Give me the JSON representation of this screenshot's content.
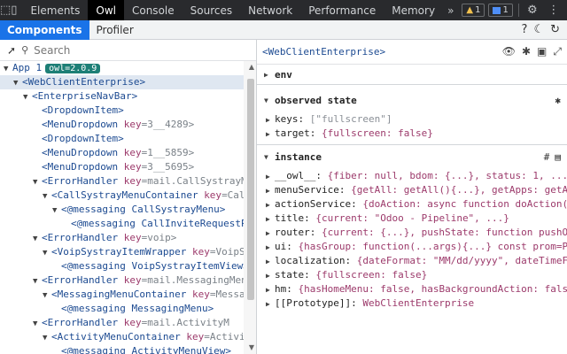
{
  "devtools": {
    "tabs": [
      "Elements",
      "Owl",
      "Console",
      "Sources",
      "Network",
      "Performance",
      "Memory"
    ],
    "active_tab": "Owl",
    "more": "»",
    "warnings_count": "1",
    "messages_count": "1"
  },
  "owl": {
    "tabs": [
      "Components",
      "Profiler"
    ],
    "active_tab": "Components"
  },
  "search": {
    "placeholder": "Search"
  },
  "tree": {
    "app": "App 1",
    "owl_version": "owl=2.0.9",
    "rows": [
      {
        "indent": 1,
        "arrow": "▼",
        "text": "<WebClientEnterprise>",
        "sel": true
      },
      {
        "indent": 2,
        "arrow": "▼",
        "text": "<EnterpriseNavBar>"
      },
      {
        "indent": 3,
        "arrow": "",
        "text": "<DropdownItem>"
      },
      {
        "indent": 3,
        "arrow": "",
        "text": "<MenuDropdown ",
        "k": "key",
        "v": "=3__4289>"
      },
      {
        "indent": 3,
        "arrow": "",
        "text": "<DropdownItem>"
      },
      {
        "indent": 3,
        "arrow": "",
        "text": "<MenuDropdown ",
        "k": "key",
        "v": "=1__5859>"
      },
      {
        "indent": 3,
        "arrow": "",
        "text": "<MenuDropdown ",
        "k": "key",
        "v": "=3__5695>"
      },
      {
        "indent": 3,
        "arrow": "▼",
        "text": "<ErrorHandler ",
        "k": "key",
        "v": "=mail.CallSystrayMe"
      },
      {
        "indent": 4,
        "arrow": "▼",
        "text": "<CallSystrayMenuContainer ",
        "k": "key",
        "v": "=CallS"
      },
      {
        "indent": 5,
        "arrow": "▼",
        "text": "<@messaging CallSystrayMenu>"
      },
      {
        "indent": 6,
        "arrow": "",
        "text": "<@messaging CallInviteRequestPo"
      },
      {
        "indent": 3,
        "arrow": "▼",
        "text": "<ErrorHandler ",
        "k": "key",
        "v": "=voip>"
      },
      {
        "indent": 4,
        "arrow": "▼",
        "text": "<VoipSystrayItemWrapper ",
        "k": "key",
        "v": "=VoipSy"
      },
      {
        "indent": 5,
        "arrow": "",
        "text": "<@messaging VoipSystrayItemView>"
      },
      {
        "indent": 3,
        "arrow": "▼",
        "text": "<ErrorHandler ",
        "k": "key",
        "v": "=mail.MessagingMenu"
      },
      {
        "indent": 4,
        "arrow": "▼",
        "text": "<MessagingMenuContainer ",
        "k": "key",
        "v": "=Messag"
      },
      {
        "indent": 5,
        "arrow": "",
        "text": "<@messaging MessagingMenu>"
      },
      {
        "indent": 3,
        "arrow": "▼",
        "text": "<ErrorHandler ",
        "k": "key",
        "v": "=mail.ActivityM"
      },
      {
        "indent": 4,
        "arrow": "▼",
        "text": "<ActivityMenuContainer ",
        "k": "key",
        "v": "=ActivityMe"
      },
      {
        "indent": 5,
        "arrow": "",
        "text": "<@messaging ActivityMenuView>"
      }
    ]
  },
  "detail": {
    "component": "<WebClientEnterprise>",
    "env_label": "env",
    "observed_label": "observed state",
    "observed": [
      {
        "k": "keys:",
        "v": "[\"fullscreen\"]",
        "style": "str"
      },
      {
        "k": "target:",
        "v": "{fullscreen: false}"
      }
    ],
    "instance_label": "instance",
    "instance": [
      {
        "k": "__owl__:",
        "v": "{fiber: null, bdom: {...}, status: 1, ..."
      },
      {
        "k": "menuService:",
        "v": "{getAll: getAll(){...}, getApps: getApps"
      },
      {
        "k": "actionService:",
        "v": "{doAction: async function doAction(ac"
      },
      {
        "k": "title:",
        "v": "{current: \"Odoo - Pipeline\", ...}"
      },
      {
        "k": "router:",
        "v": "{current: {...}, pushState: function pushOrR"
      },
      {
        "k": "ui:",
        "v": "{hasGroup: function(...args){...} const prom=P"
      },
      {
        "k": "localization:",
        "v": "{dateFormat: \"MM/dd/yyyy\", dateTimeFor"
      },
      {
        "k": "state:",
        "v": "{fullscreen: false}"
      },
      {
        "k": "hm:",
        "v": "{hasHomeMenu: false, hasBackgroundAction: false,"
      },
      {
        "k": "[[Prototype]]:",
        "v": "WebClientEnterprise",
        "style": "proto"
      }
    ]
  }
}
